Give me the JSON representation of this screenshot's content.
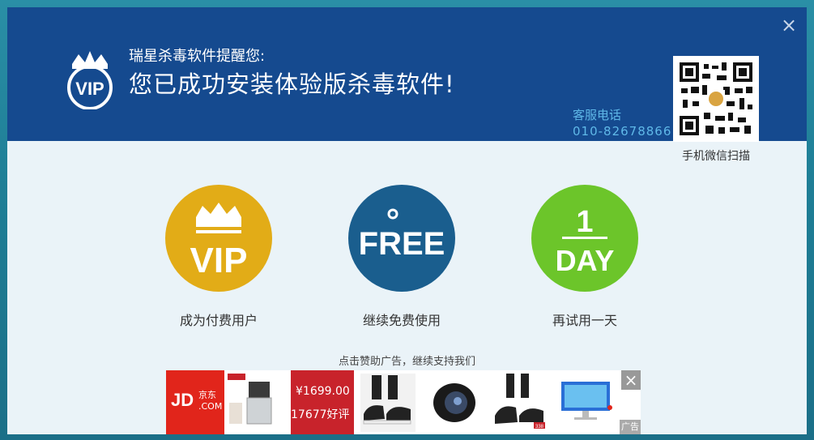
{
  "header": {
    "line1": "瑞星杀毒软件提醒您:",
    "line2": "您已成功安装体验版杀毒软件!",
    "service_label": "客服电话",
    "service_phone": "010-82678866",
    "qr_caption": "手机微信扫描",
    "close_icon": "×"
  },
  "logo": {
    "text": "VIP"
  },
  "options": [
    {
      "icon_text": "VIP",
      "label": "成为付费用户",
      "color": "#e2ac17"
    },
    {
      "icon_text": "FREE",
      "label": "继续免费使用",
      "color": "#1a5e8e"
    },
    {
      "icon_text_top": "1",
      "icon_text_bottom": "DAY",
      "label": "再试用一天",
      "color": "#6cc52a"
    }
  ],
  "sponsor": {
    "text": "点击赞助广告，继续支持我们"
  },
  "ad": {
    "brand": "JD",
    "brand_sub": "京东",
    "brand_domain": ".COM",
    "price": "¥1699.00",
    "reviews": "17677好评",
    "close_icon": "×",
    "tag": "广告",
    "mini_price": "338"
  },
  "colors": {
    "header_bg": "#154a8f",
    "body_bg": "#eaf3f8",
    "accent_blue": "#5fb8e8",
    "jd_red": "#e1251b"
  }
}
